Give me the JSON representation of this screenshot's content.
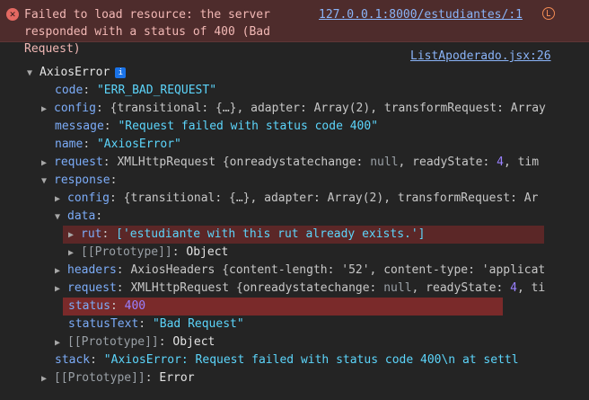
{
  "error": {
    "message": "Failed to load resource: the server\nresponded with a status of 400 (Bad Request)",
    "link": "127.0.0.1:8000/estudiantes/:1"
  },
  "source_link": "ListApoderado.jsx:26",
  "tree": {
    "root_label": "AxiosError",
    "code_key": "code",
    "code_val": "\"ERR_BAD_REQUEST\"",
    "config_key": "config",
    "config_preview": "{transitional: {…}, adapter: Array(2), transformRequest: Array",
    "message_key": "message",
    "message_val": "\"Request failed with status code 400\"",
    "name_key": "name",
    "name_val": "\"AxiosError\"",
    "request_key": "request",
    "request_preview_a": "XMLHttpRequest {onreadystatechange: ",
    "request_null": "null",
    "request_preview_b": ", readyState: ",
    "request_rs": "4",
    "request_preview_c": ", tim",
    "response_key": "response",
    "resp_config_key": "config",
    "resp_config_preview": "{transitional: {…}, adapter: Array(2), transformRequest: Ar",
    "data_key": "data",
    "rut_key": "rut",
    "rut_val": "['estudiante with this rut already exists.']",
    "data_proto_key": "[[Prototype]]",
    "data_proto_val": "Object",
    "headers_key": "headers",
    "headers_preview": "AxiosHeaders {content-length: '52', content-type: 'applicat",
    "resp_request_key": "request",
    "resp_request_a": "XMLHttpRequest {onreadystatechange: ",
    "resp_request_null": "null",
    "resp_request_b": ", readyState: ",
    "resp_request_rs": "4",
    "resp_request_c": ", ti",
    "status_key": "status",
    "status_val": "400",
    "statusText_key": "statusText",
    "statusText_val": "\"Bad Request\"",
    "resp_proto_key": "[[Prototype]]",
    "resp_proto_val": "Object",
    "stack_key": "stack",
    "stack_val": "\"AxiosError: Request failed with status code 400\\n    at settl",
    "root_proto_key": "[[Prototype]]",
    "root_proto_val": "Error"
  },
  "colors": {
    "background": "#242424",
    "error_bg": "#4e2c2c",
    "key": "#7cacf8",
    "string": "#5cd5fb",
    "number": "#9980ff",
    "highlight": "#7a2a2a"
  }
}
